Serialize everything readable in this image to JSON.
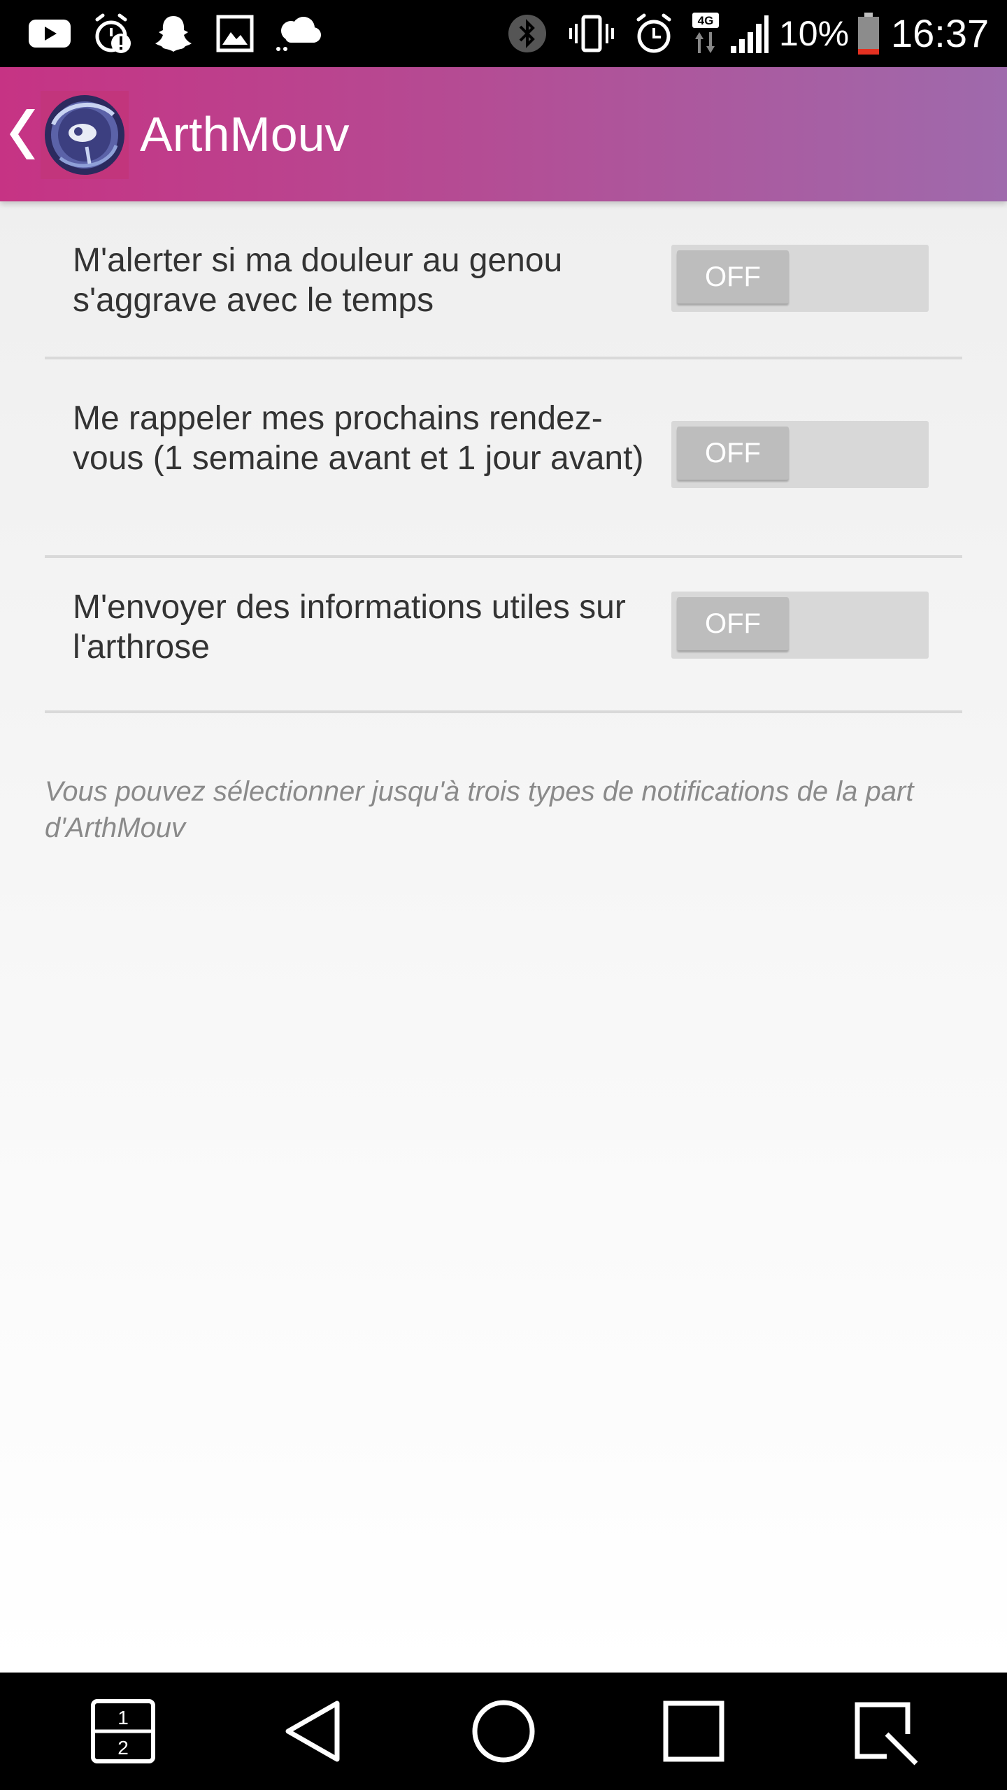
{
  "status_bar": {
    "battery_percent": "10%",
    "time": "16:37",
    "network_label": "4G",
    "icons": [
      "youtube-icon",
      "alarm-alert-icon",
      "snapchat-icon",
      "image-icon",
      "weather-icon",
      "bluetooth-icon",
      "vibrate-icon",
      "alarm-icon",
      "network-4g-icon",
      "signal-icon",
      "battery-icon"
    ]
  },
  "app_bar": {
    "title": "ArthMouv",
    "back_icon": "chevron-left-icon",
    "logo_icon": "app-logo-icon"
  },
  "settings": [
    {
      "label": "M'alerter si ma douleur au genou s'aggrave avec le temps",
      "toggle_state": "OFF"
    },
    {
      "label": "Me rappeler mes prochains rendez-vous (1 semaine avant et 1 jour avant)",
      "toggle_state": "OFF"
    },
    {
      "label": "M'envoyer des informations utiles sur l'arthrose",
      "toggle_state": "OFF"
    }
  ],
  "footnote": "Vous pouvez sélectionner jusqu'à trois types de notifications de la part d'ArthMouv",
  "nav_bar": {
    "dual_window_digits": [
      "1",
      "2"
    ],
    "icons": [
      "dual-window-icon",
      "back-icon",
      "home-icon",
      "recent-apps-icon",
      "capture-icon"
    ]
  },
  "colors": {
    "app_bar_start": "#c63384",
    "app_bar_end": "#9f6aac",
    "toggle_track": "#d8d8d8",
    "toggle_knob": "#bdbdbd",
    "divider": "#d9d9d9",
    "label_text": "#333333",
    "footnote_text": "#8a8a8a"
  }
}
